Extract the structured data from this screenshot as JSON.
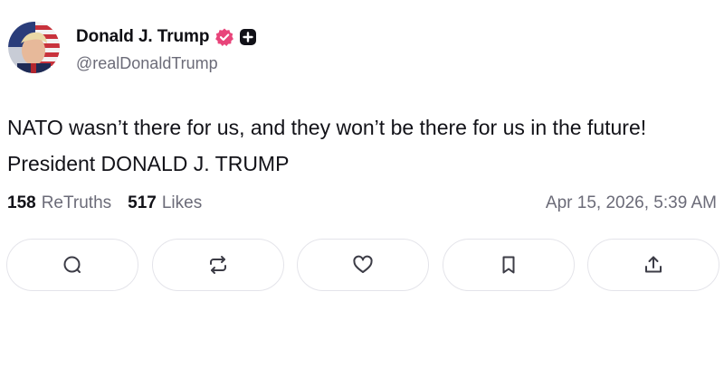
{
  "author": {
    "display_name": "Donald J. Trump",
    "handle": "@realDonaldTrump",
    "verified_color": "#e8447a"
  },
  "post": {
    "text": "NATO wasn’t there for us, and they won’t be there for us in the future! President DONALD J. TRUMP"
  },
  "stats": {
    "retruths_count": "158",
    "retruths_label": "ReTruths",
    "likes_count": "517",
    "likes_label": "Likes",
    "timestamp": "Apr 15, 2026, 5:39 AM"
  },
  "actions": [
    {
      "icon": "reply-icon"
    },
    {
      "icon": "retruth-icon"
    },
    {
      "icon": "heart-icon"
    },
    {
      "icon": "bookmark-icon"
    },
    {
      "icon": "share-icon"
    }
  ]
}
